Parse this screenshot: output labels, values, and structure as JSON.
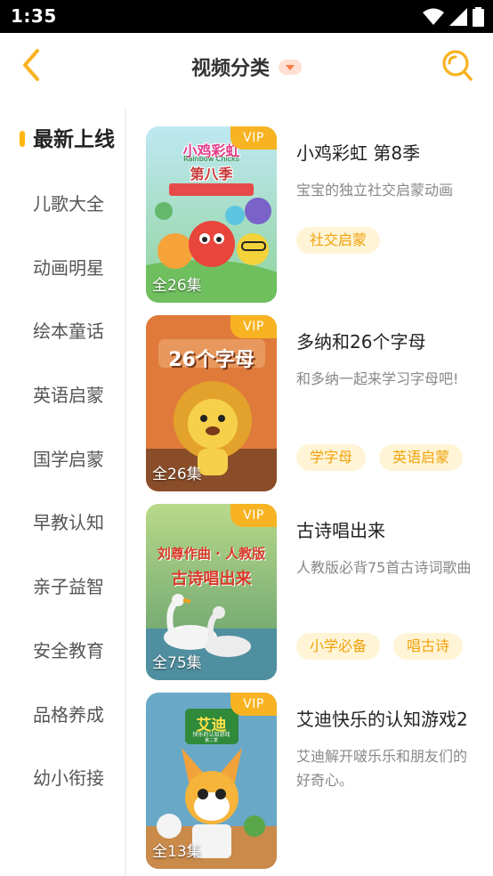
{
  "status_bar": {
    "time": "1:35"
  },
  "header": {
    "title": "视频分类"
  },
  "sidebar": {
    "items": [
      {
        "label": "最新上线",
        "active": true
      },
      {
        "label": "儿歌大全"
      },
      {
        "label": "动画明星"
      },
      {
        "label": "绘本童话"
      },
      {
        "label": "英语启蒙"
      },
      {
        "label": "国学启蒙"
      },
      {
        "label": "早教认知"
      },
      {
        "label": "亲子益智"
      },
      {
        "label": "安全教育"
      },
      {
        "label": "品格养成"
      },
      {
        "label": "幼小衔接"
      }
    ]
  },
  "videos": [
    {
      "title": "小鸡彩虹 第8季",
      "desc": "宝宝的独立社交启蒙动画",
      "episodes": "全26集",
      "badge": "VIP",
      "tags": [
        "社交启蒙"
      ],
      "poster_title": "第八季",
      "poster_subtitle": "Rainbow Chicks",
      "poster_logo": "小鸡彩虹"
    },
    {
      "title": "多纳和26个字母",
      "desc": "和多纳一起来学习字母吧!",
      "episodes": "全26集",
      "badge": "VIP",
      "tags": [
        "学字母",
        "英语启蒙"
      ],
      "poster_title": "26个字母"
    },
    {
      "title": "古诗唱出来",
      "desc": "人教版必背75首古诗词歌曲",
      "episodes": "全75集",
      "badge": "VIP",
      "tags": [
        "小学必备",
        "唱古诗"
      ],
      "poster_title": "古诗唱出来",
      "poster_subtitle": "刘尊作曲 · 人教版"
    },
    {
      "title": "艾迪快乐的认知游戏2",
      "desc": "艾迪解开啵乐乐和朋友们的好奇心。",
      "episodes": "全13集",
      "badge": "VIP",
      "tags": [],
      "poster_title": "艾迪",
      "poster_subtitle": "快乐的认知游戏",
      "poster_season": "第二季"
    }
  ],
  "colors": {
    "accent": "#f7b321",
    "tag_bg": "#fff4d6",
    "tag_text": "#f0a20a",
    "caret": "#ff7a45"
  }
}
